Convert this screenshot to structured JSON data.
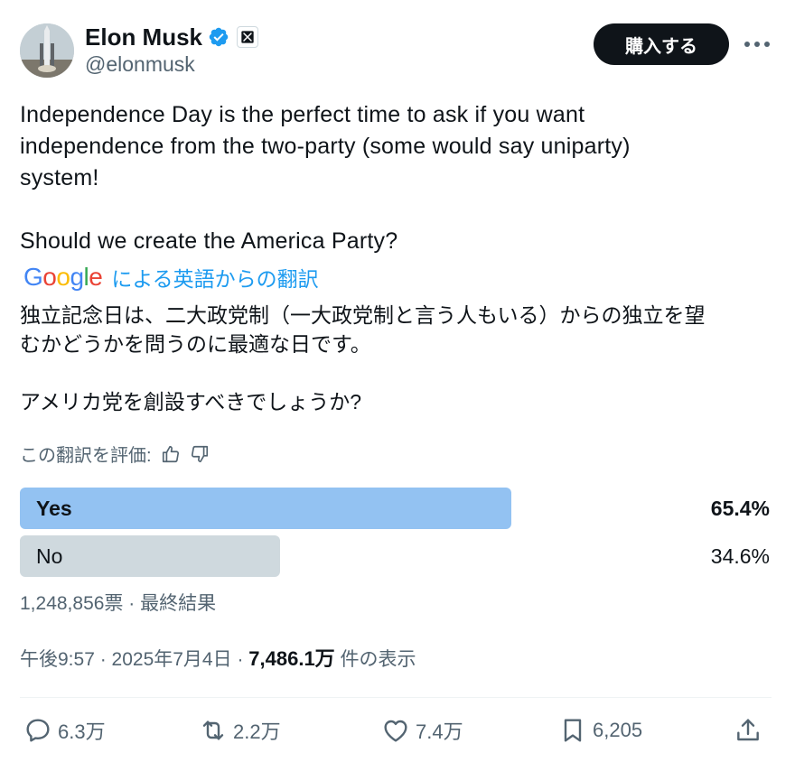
{
  "author": {
    "name": "Elon Musk",
    "handle": "@elonmusk"
  },
  "header": {
    "buy_button_label": "購入する"
  },
  "tweet": {
    "text": "Independence Day is the perfect time to ask if you want\nindependence from the two-party (some would say uniparty)\nsystem!\n\nShould we create the America Party?",
    "translation_link": "による英語からの翻訳",
    "translated_text": "独立記念日は、二大政党制（一大政党制と言う人もいる）からの独立を望\nむかどうかを問うのに最適な日です。\n\nアメリカ党を創設すべきでしょうか?",
    "rate_translation_label": "この翻訳を評価:"
  },
  "poll": {
    "options": [
      {
        "label": "Yes",
        "percent_label": "65.4%",
        "percent": 65.4,
        "leading": true
      },
      {
        "label": "No",
        "percent_label": "34.6%",
        "percent": 34.6,
        "leading": false
      }
    ],
    "summary": "1,248,856票 · 最終結果"
  },
  "meta": {
    "time_date": "午後9:57 · 2025年7月4日 · ",
    "views": "7,486.1万",
    "views_suffix": " 件の表示"
  },
  "actions": {
    "replies": "6.3万",
    "reposts": "2.2万",
    "likes": "7.4万",
    "bookmarks": "6,205"
  },
  "colors": {
    "leading_bar": "#93c2f2",
    "other_bar": "#cfd9de",
    "verified": "#1d9bf0",
    "link": "#1d9bf0"
  },
  "icons": [
    "verified-badge-icon",
    "x-logo-icon",
    "more-icon",
    "thumbs-up-icon",
    "thumbs-down-icon",
    "reply-icon",
    "repost-icon",
    "like-icon",
    "bookmark-icon",
    "share-icon"
  ]
}
